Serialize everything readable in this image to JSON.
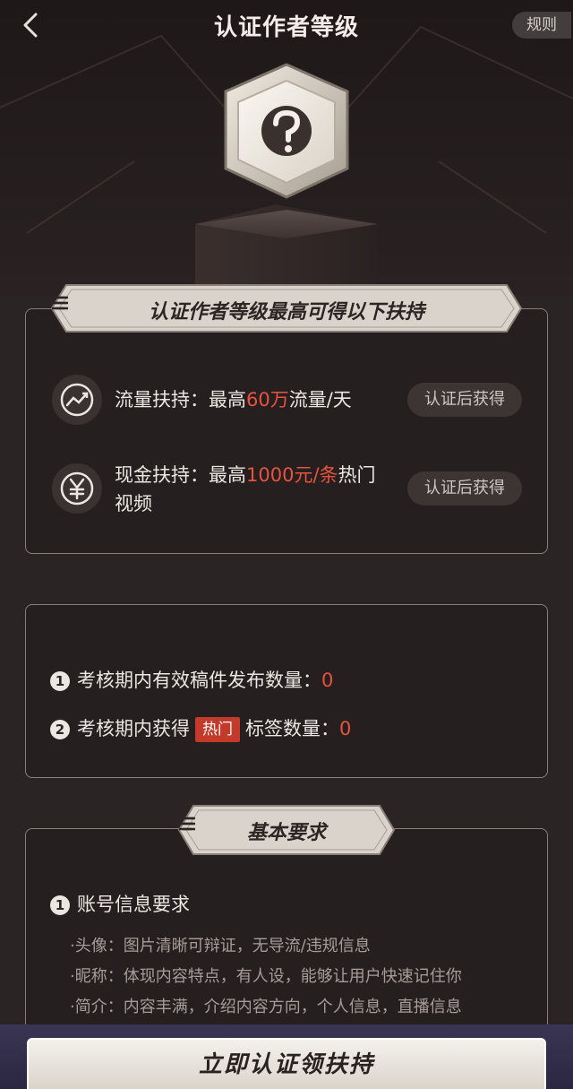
{
  "header": {
    "title": "认证作者等级",
    "rules_label": "规则"
  },
  "badge": {
    "icon": "question-mark-badge-icon"
  },
  "support_section": {
    "title": "认证作者等级最高可得以下扶持",
    "items": [
      {
        "icon": "traffic-icon",
        "prefix": "流量扶持：最高",
        "highlight": "60万",
        "suffix": "流量/天",
        "status": "认证后获得"
      },
      {
        "icon": "yuan-icon",
        "prefix": "现金扶持：最高",
        "highlight": "1000元/条",
        "suffix": "热门视频",
        "status": "认证后获得"
      }
    ]
  },
  "criteria": {
    "items": [
      {
        "num": "1",
        "label": "考核期内有效稿件发布数量：",
        "value": "0"
      },
      {
        "num": "2",
        "label_before": "考核期内获得",
        "tag": "热门",
        "label_after": "标签数量：",
        "value": "0"
      }
    ]
  },
  "requirements_section": {
    "title": "基本要求",
    "item_num": "1",
    "item_title": "账号信息要求",
    "details": [
      "·头像：图片清晰可辩证，无导流/违规信息",
      "·昵称：体现内容特点，有人设，能够让用户快速记住你",
      "·简介：内容丰满，介绍内容方向，个人信息，直播信息"
    ]
  },
  "cta": {
    "label": "立即认证领扶持"
  },
  "colors": {
    "highlight": "#e8533f",
    "hot_tag": "#c23a2a",
    "background": "#2b2424"
  }
}
